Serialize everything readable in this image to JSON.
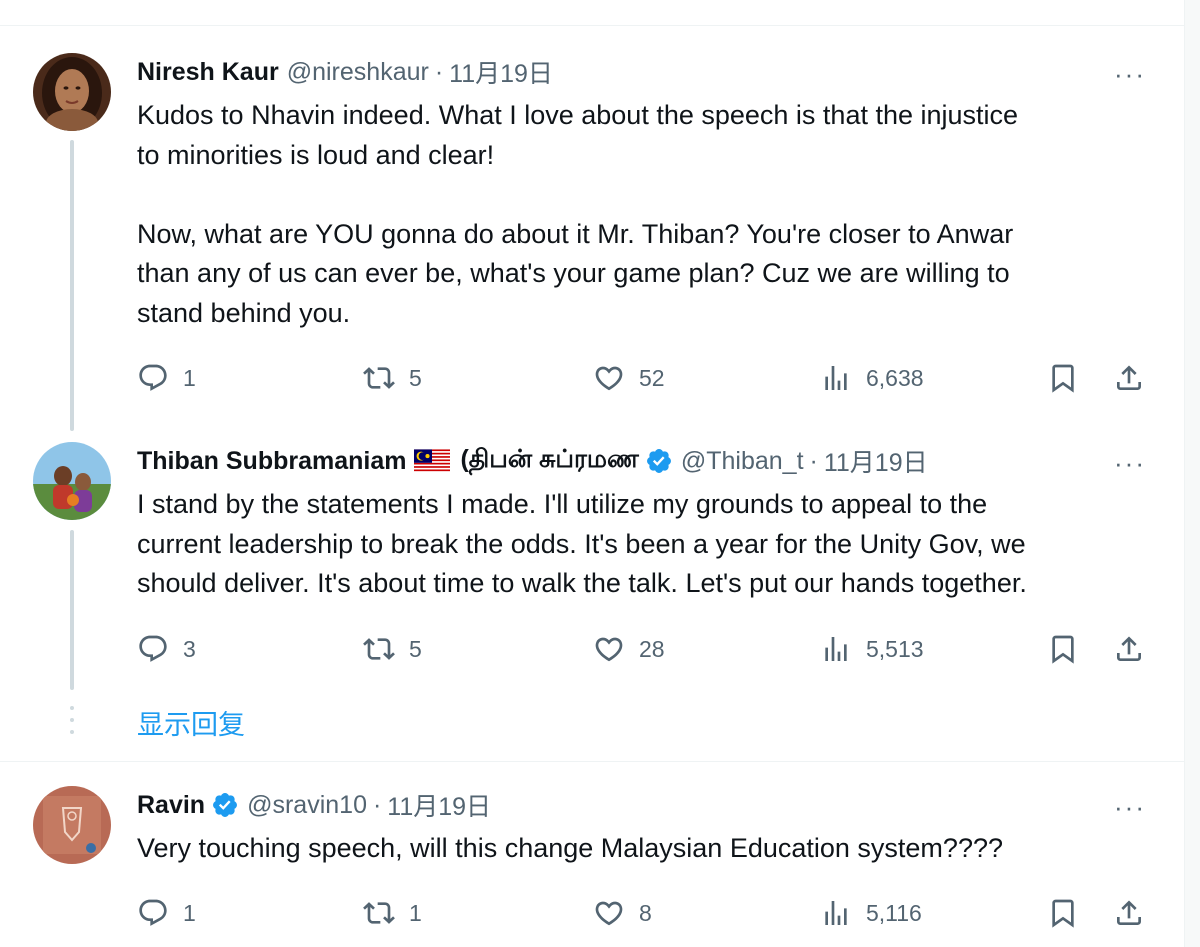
{
  "colors": {
    "accent": "#1d9bf0",
    "text": "#0f1419",
    "muted": "#536471"
  },
  "tweets": [
    {
      "name": "Niresh Kaur",
      "handle": "@nireshkaur",
      "separator": "·",
      "date": "11月19日",
      "more": "···",
      "text": "Kudos to Nhavin indeed. What I love about the speech is that the injustice\nto minorities is loud and clear!\n\nNow, what are YOU gonna do about it Mr. Thiban? You're closer to Anwar\nthan any of us can ever be, what's your game plan? Cuz we are willing to\nstand behind you.",
      "replies": "1",
      "retweets": "5",
      "likes": "52",
      "views": "6,638"
    },
    {
      "name": "Thiban Subbramaniam",
      "name_suffix": "(திபன் சுப்ரமண",
      "handle": "@Thiban_t",
      "separator": "·",
      "date": "11月19日",
      "more": "···",
      "text": "I stand by the statements I made. I'll utilize my grounds to appeal to the\ncurrent leadership to break the odds. It's been a year for the Unity Gov, we\nshould deliver. It's about time to walk the talk. Let's put our hands together.",
      "replies": "3",
      "retweets": "5",
      "likes": "28",
      "views": "5,513"
    },
    {
      "name": "Ravin",
      "handle": "@sravin10",
      "separator": "·",
      "date": "11月19日",
      "more": "···",
      "text": "Very touching speech, will this change Malaysian Education system????",
      "replies": "1",
      "retweets": "1",
      "likes": "8",
      "views": "5,116"
    }
  ],
  "show_replies": "显示回复",
  "icons": [
    "reply-icon",
    "retweet-icon",
    "like-icon",
    "views-icon",
    "bookmark-icon",
    "share-icon",
    "verified-icon",
    "more-icon",
    "malaysia-flag-icon"
  ]
}
